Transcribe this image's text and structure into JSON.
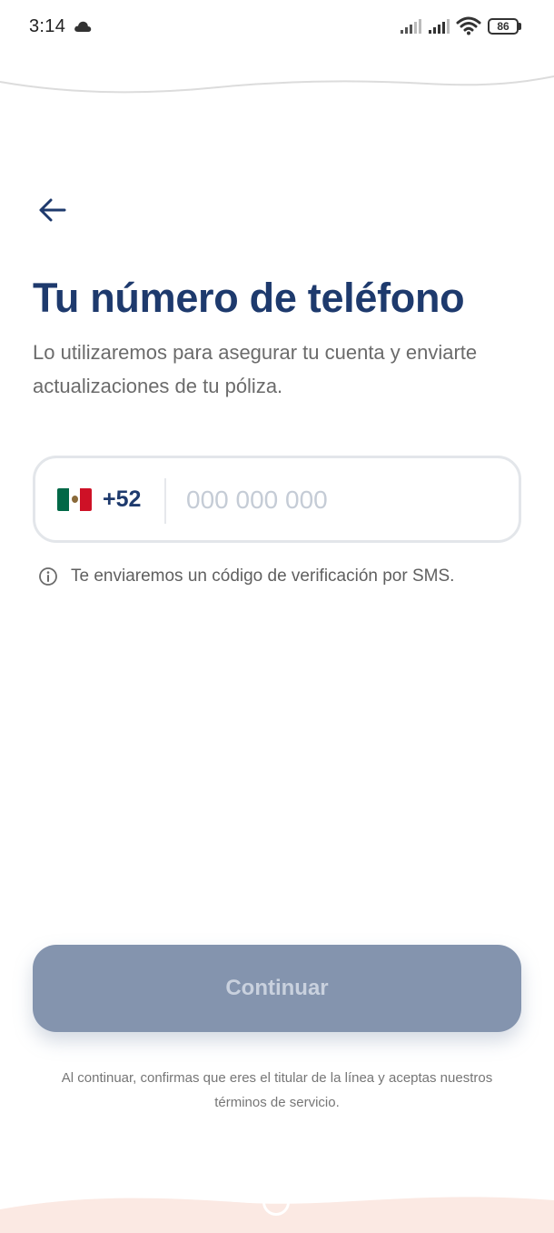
{
  "status_bar": {
    "time": "3:14",
    "battery": "86",
    "icons": [
      "cloud-icon",
      "signal-icon",
      "signal-icon",
      "wifi-icon",
      "battery-icon"
    ]
  },
  "header": {
    "back_icon": "arrow-left-icon",
    "title": "Tu número de teléfono",
    "subtitle": "Lo utilizaremos para asegurar tu cuenta y enviarte actualizaciones de tu póliza."
  },
  "phone_field": {
    "country_flag": "mexico-flag-icon",
    "country_code": "+52",
    "value": "",
    "placeholder": "000 000 000"
  },
  "info": {
    "icon": "info-icon",
    "text": "Te enviaremos un código de verificación por SMS."
  },
  "actions": {
    "continue_label": "Continuar",
    "continue_enabled": false
  },
  "legal": {
    "text": "Al continuar, confirmas que eres el titular de la línea y aceptas nuestros términos de servicio."
  },
  "colors": {
    "primary": "#1e3a6d",
    "button_disabled": "#8494ae",
    "button_label_disabled": "#c9d1de",
    "border": "#e3e6ea",
    "placeholder": "#c5ccd6",
    "bottom_wave": "#fbe9e3"
  }
}
